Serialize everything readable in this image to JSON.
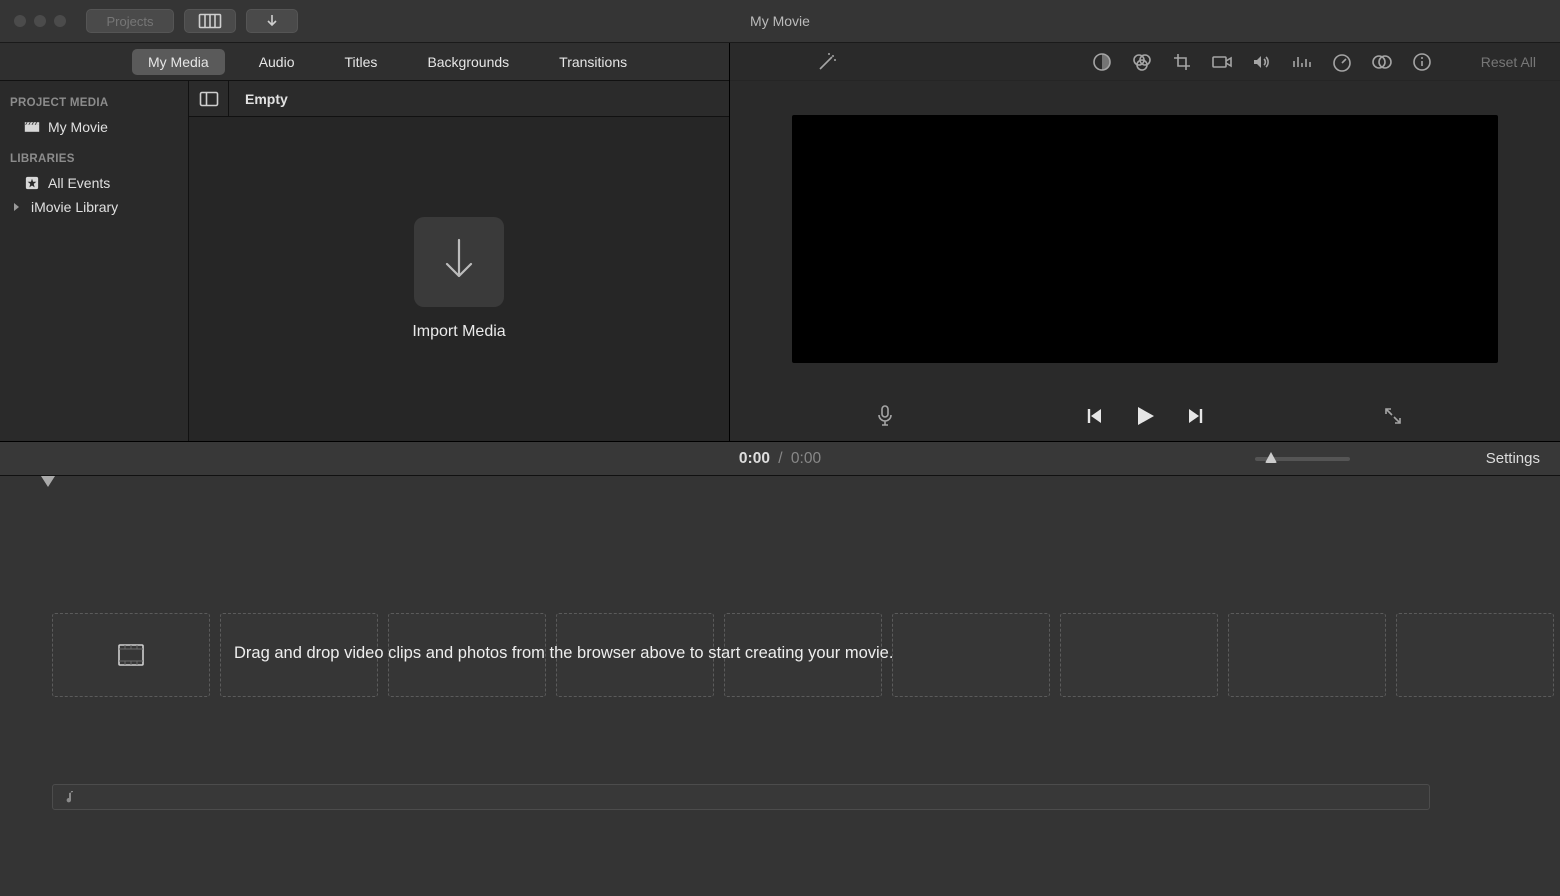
{
  "window": {
    "title": "My Movie",
    "projects_button": "Projects"
  },
  "tabs": {
    "my_media": "My Media",
    "audio": "Audio",
    "titles": "Titles",
    "backgrounds": "Backgrounds",
    "transitions": "Transitions"
  },
  "sidebar": {
    "project_media_header": "PROJECT MEDIA",
    "project_name": "My Movie",
    "libraries_header": "LIBRARIES",
    "all_events": "All Events",
    "imovie_library": "iMovie Library"
  },
  "browser": {
    "header": "Empty",
    "import_label": "Import Media"
  },
  "adjust": {
    "reset_all": "Reset All"
  },
  "time": {
    "current": "0:00",
    "separator": "/",
    "duration": "0:00"
  },
  "timeline": {
    "settings": "Settings",
    "hint": "Drag and drop video clips and photos from the browser above to start creating your movie."
  }
}
